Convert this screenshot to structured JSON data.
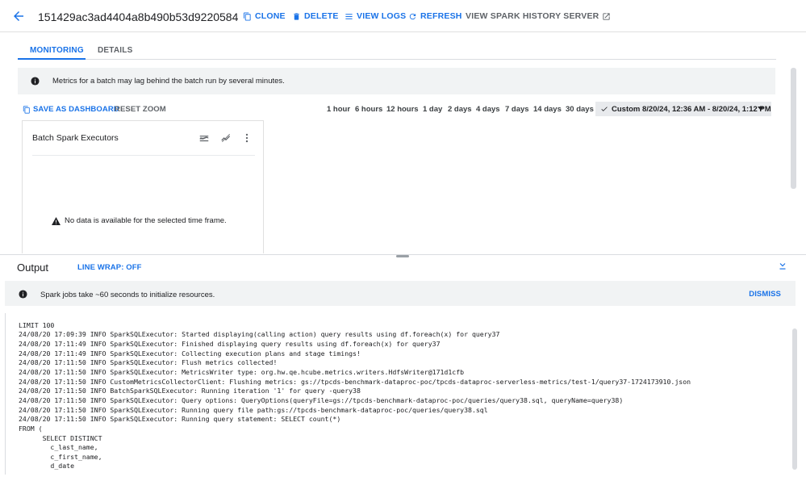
{
  "header": {
    "batch_id": "151429ac3ad4404a8b490b53d9220584",
    "actions": {
      "clone": "CLONE",
      "delete": "DELETE",
      "view_logs": "VIEW LOGS",
      "refresh": "REFRESH",
      "history": "VIEW SPARK HISTORY SERVER"
    }
  },
  "tabs": {
    "monitoring": "MONITORING",
    "details": "DETAILS"
  },
  "metrics_banner": "Metrics for a batch may lag behind the batch run by several minutes.",
  "dashboard": {
    "save": "SAVE AS DASHBOARD",
    "reset_zoom": "RESET ZOOM",
    "ranges": [
      "1 hour",
      "6 hours",
      "12 hours",
      "1 day",
      "2 days",
      "4 days",
      "7 days",
      "14 days",
      "30 days"
    ],
    "custom_range": "Custom 8/20/24, 12:36 AM - 8/20/24, 1:12 PM"
  },
  "chart_card": {
    "title": "Batch Spark Executors",
    "no_data": "No data is available for the selected time frame."
  },
  "output": {
    "title": "Output",
    "line_wrap": "LINE WRAP: OFF",
    "banner": "Spark jobs take ~60 seconds to initialize resources.",
    "dismiss": "DISMISS",
    "lines": [
      "LIMIT 100",
      "24/08/20 17:09:39 INFO SparkSQLExecutor: Started displaying(calling action) query results using df.foreach(x) for query37",
      "24/08/20 17:11:49 INFO SparkSQLExecutor: Finished displaying query results using df.foreach(x) for query37",
      "24/08/20 17:11:49 INFO SparkSQLExecutor: Collecting execution plans and stage timings!",
      "24/08/20 17:11:50 INFO SparkSQLExecutor: Flush metrics collected!",
      "24/08/20 17:11:50 INFO SparkSQLExecutor: MetricsWriter type: org.hw.qe.hcube.metrics.writers.HdfsWriter@171d1cfb",
      "24/08/20 17:11:50 INFO CustomMetricsCollectorClient: Flushing metrics: gs://tpcds-benchmark-dataproc-poc/tpcds-dataproc-serverless-metrics/test-1/query37-1724173910.json",
      "24/08/20 17:11:50 INFO BatchSparkSQLExecutor: Running iteration '1' for query -query38",
      "24/08/20 17:11:50 INFO SparkSQLExecutor: Query options: QueryOptions(queryFile=gs://tpcds-benchmark-dataproc-poc/queries/query38.sql, queryName=query38)",
      "24/08/20 17:11:50 INFO SparkSQLExecutor: Running query file path:gs://tpcds-benchmark-dataproc-poc/queries/query38.sql",
      "24/08/20 17:11:50 INFO SparkSQLExecutor: Running query statement: SELECT count(*)",
      "FROM (",
      "      SELECT DISTINCT",
      "        c_last_name,",
      "        c_first_name,",
      "        d_date"
    ]
  },
  "colors": {
    "accent": "#1a73e8",
    "banner_bg": "#f1f3f4",
    "muted": "#5f6368"
  }
}
